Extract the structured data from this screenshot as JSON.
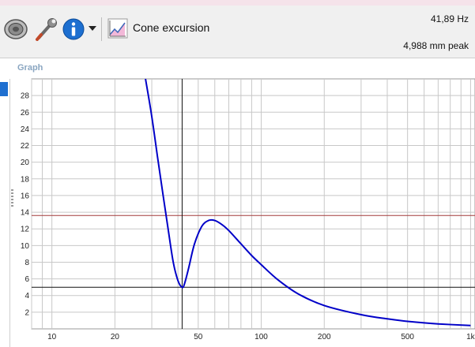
{
  "toolbar": {
    "mode_label": "Cone excursion",
    "icons": [
      "speaker-icon",
      "wrench-icon",
      "info-icon",
      "dropdown-arrow-icon",
      "cone-excursion-icon"
    ]
  },
  "readout": {
    "frequency": "41,89 Hz",
    "excursion": "4,988 mm peak"
  },
  "graph": {
    "caption": "Graph"
  },
  "colors": {
    "curve": "#0000c8",
    "limit_line": "#a33a3a",
    "cursor_line": "#111111",
    "grid": "#c8c8c8",
    "accent": "#1e6fd0"
  },
  "chart_data": {
    "type": "line",
    "title": "",
    "xlabel": "",
    "ylabel": "",
    "x_scale": "log",
    "xlim": [
      8,
      1050
    ],
    "ylim": [
      0,
      30
    ],
    "x_ticks": [
      {
        "value": 10,
        "label": "10"
      },
      {
        "value": 20,
        "label": "20"
      },
      {
        "value": 50,
        "label": "50"
      },
      {
        "value": 100,
        "label": "100"
      },
      {
        "value": 200,
        "label": "200"
      },
      {
        "value": 500,
        "label": "500"
      },
      {
        "value": 1000,
        "label": "1k"
      }
    ],
    "y_ticks": [
      {
        "value": 2,
        "label": "2"
      },
      {
        "value": 4,
        "label": "4"
      },
      {
        "value": 6,
        "label": "6"
      },
      {
        "value": 8,
        "label": "8"
      },
      {
        "value": 10,
        "label": "10"
      },
      {
        "value": 12,
        "label": "12"
      },
      {
        "value": 14,
        "label": "14"
      },
      {
        "value": 16,
        "label": "16"
      },
      {
        "value": 18,
        "label": "18"
      },
      {
        "value": 20,
        "label": "20"
      },
      {
        "value": 22,
        "label": "22"
      },
      {
        "value": 24,
        "label": "24"
      },
      {
        "value": 26,
        "label": "26"
      },
      {
        "value": 28,
        "label": "28"
      }
    ],
    "grid": true,
    "series": [
      {
        "x": [
          28,
          30,
          32,
          34,
          36,
          38,
          40,
          41.89,
          43,
          45,
          48,
          52,
          56,
          60,
          65,
          70,
          80,
          90,
          100,
          120,
          150,
          200,
          300,
          400,
          500,
          700,
          1000
        ],
        "y": [
          30,
          25.5,
          20.5,
          16,
          11.8,
          8,
          5.8,
          4.988,
          5.4,
          7.3,
          10.2,
          12.3,
          13.0,
          13.0,
          12.5,
          11.8,
          10.2,
          8.8,
          7.7,
          5.9,
          4.2,
          2.8,
          1.7,
          1.2,
          0.9,
          0.6,
          0.4
        ]
      }
    ],
    "reference_lines": [
      {
        "axis": "y",
        "value": 13.6
      },
      {
        "axis": "y",
        "value": 4.988
      },
      {
        "axis": "x",
        "value": 41.89
      }
    ]
  }
}
